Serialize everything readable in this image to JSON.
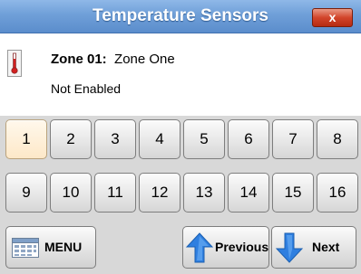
{
  "window": {
    "title": "Temperature Sensors",
    "close_label": "x"
  },
  "zone": {
    "label": "Zone 01:",
    "name": "Zone One",
    "status": "Not Enabled"
  },
  "zone_buttons": [
    "1",
    "2",
    "3",
    "4",
    "5",
    "6",
    "7",
    "8",
    "9",
    "10",
    "11",
    "12",
    "13",
    "14",
    "15",
    "16"
  ],
  "selected_zone": "1",
  "nav": {
    "menu_label": "MENU",
    "previous_label": "Previous",
    "next_label": "Next"
  },
  "colors": {
    "titlebar": "#6f9fd8",
    "close": "#d2452b",
    "selected_button": "#fde8c8",
    "arrow": "#2f7fe0"
  }
}
